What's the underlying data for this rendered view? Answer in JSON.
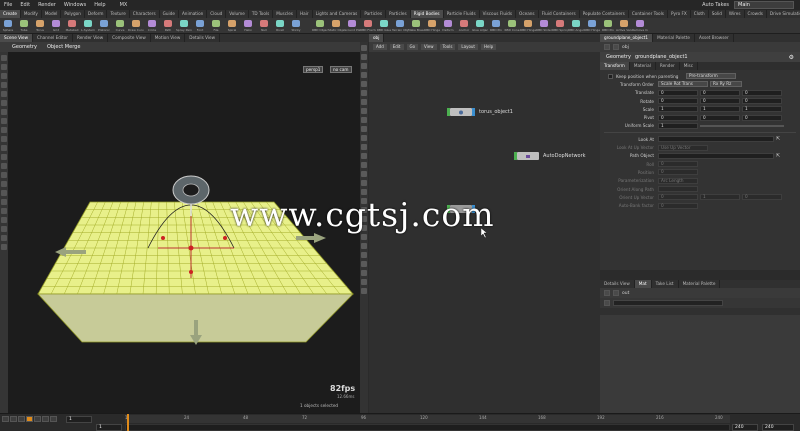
{
  "menubar": {
    "items": [
      "File",
      "Edit",
      "Render",
      "Windows",
      "Help"
    ],
    "extra": "MX",
    "auto_takes": "Auto Takes",
    "desktop": "Main"
  },
  "shelf": {
    "tabs_left": [
      "Create",
      "Modify",
      "Model",
      "Polygon",
      "Deform",
      "Texture",
      "Characters",
      "Guide",
      "Animation",
      "Cloud",
      "Volume",
      "TD Tools",
      "Muscles",
      "Hair"
    ],
    "tabs_right": [
      "Lights and Cameras",
      "Particles",
      "Particles",
      "Rigid Bodies",
      "Particle Fluids",
      "Viscous Fluids",
      "Oceans",
      "Fluid Containers",
      "Populate Containers",
      "Container Tools",
      "Pyro FX",
      "Cloth",
      "Solid",
      "Wires",
      "Crowds",
      "Drive Simulation"
    ],
    "tools_left": [
      "Sphere",
      "Tube",
      "Torus",
      "Grid",
      "Metaball",
      "L-System",
      "Platonic",
      "Curve",
      "Draw Curve",
      "Circle",
      "Path",
      "Spray Paint",
      "Font",
      "File",
      "Spiral",
      "Helix",
      "Null",
      "Rivet",
      "Sticky"
    ],
    "tools_right": [
      "RBD Object",
      "Static Object",
      "Ground Plane",
      "RBD Fractured",
      "RBD Glue",
      "Terrain Object",
      "Make Breakable",
      "RBD Hinge",
      "Deform",
      "Anchor",
      "Glue Adjacent",
      "RBD Pin",
      "RBD Cone",
      "RBD Hinge",
      "RBD Slider",
      "RBD Spring",
      "RBD Angular",
      "RBD Hinge",
      "RBD Pin",
      "Active Value",
      "Remove Constraint"
    ]
  },
  "scene_panel": {
    "tabs": [
      "Scene View",
      "Channel Editor",
      "Render View",
      "Composite View",
      "Motion View",
      "Details View"
    ],
    "path": "obj",
    "header_type": "Geometry",
    "header_name": "Object Merge",
    "cam_dropdown": "persp1",
    "cam_dropdown2": "no cam",
    "fps": "82fps",
    "ms": "12.66ms",
    "selection": "1 objects selected"
  },
  "network_panel": {
    "path": "obj",
    "options": [
      "Add",
      "Edit",
      "Go",
      "View",
      "Tools",
      "Layout",
      "Help"
    ],
    "nodes": {
      "torus": "torus_object1",
      "autodop": "AutoDopNetwork"
    }
  },
  "param_panel": {
    "tabs": [
      "groundplane_object1",
      "Material Palette",
      "Asset Browser"
    ],
    "path": "obj",
    "header_type": "Geometry",
    "header_name": "groundplane_object1",
    "sub_tabs": [
      "Transform",
      "Material",
      "Render",
      "Misc"
    ],
    "keep_position_label": "Keep position when parenting",
    "keep_position_value": "Pre-transform",
    "transform_order": {
      "label": "Transform Order",
      "value1": "Scale Rot Trans",
      "value2": "Rx Ry Rz"
    },
    "vectors": [
      {
        "label": "Translate",
        "x": "0",
        "y": "0",
        "z": "0"
      },
      {
        "label": "Rotate",
        "x": "0",
        "y": "0",
        "z": "0"
      },
      {
        "label": "Scale",
        "x": "1",
        "y": "1",
        "z": "1"
      },
      {
        "label": "Pivot",
        "x": "0",
        "y": "0",
        "z": "0"
      }
    ],
    "uniform_scale": {
      "label": "Uniform Scale",
      "value": "1"
    },
    "look_at": {
      "label": "Look At",
      "value": ""
    },
    "look_up": {
      "label": "Look At Up Vector",
      "value": "Use Up Vector"
    },
    "path_object": {
      "label": "Path Object",
      "value": ""
    },
    "dim_rows": [
      {
        "label": "Roll",
        "value": "0"
      },
      {
        "label": "Position",
        "value": "0"
      }
    ],
    "param_by": {
      "label": "Parameterization",
      "value": "Arc Length"
    },
    "orient": {
      "label": "Orient Along Path",
      "value": ""
    },
    "orient_up": {
      "label": "Orient Up Vector",
      "x": "0",
      "y": "1",
      "z": "0"
    },
    "auto_bank": {
      "label": "Auto-Bank factor",
      "value": "0"
    }
  },
  "details_panel": {
    "tabs": [
      "Details View",
      "Mat",
      "Take List",
      "Material Palette"
    ],
    "path": "out"
  },
  "timeline": {
    "current_frame": "1",
    "start_frame": "1",
    "end_frame": "240",
    "end_frame2": "240",
    "ticks": [
      "1",
      "24",
      "48",
      "72",
      "96",
      "120",
      "144",
      "168",
      "192",
      "216",
      "240"
    ]
  },
  "watermark": "www.cgtsj.com",
  "colors": {
    "grid_fill": "#e8f08a",
    "grid_line": "#a4ae2a",
    "playhead": "#e08b1a",
    "node_green": "#4caf50",
    "node_blue": "#3a8fd0"
  }
}
